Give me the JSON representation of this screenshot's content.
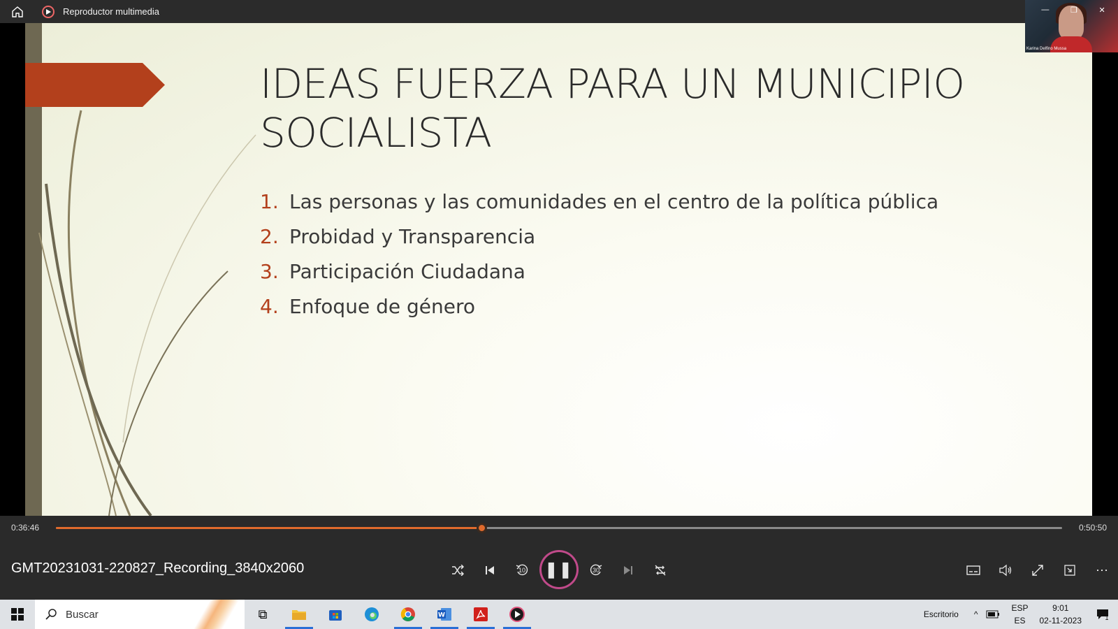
{
  "window": {
    "app_title": "Reproductor multimedia"
  },
  "slide": {
    "title": "IDEAS FUERZA PARA UN MUNICIPIO SOCIALISTA",
    "items": [
      {
        "num": "1.",
        "text": "Las personas y las comunidades en el centro de la política pública"
      },
      {
        "num": "2.",
        "text": "Probidad y Transparencia"
      },
      {
        "num": "3.",
        "text": "Participación Ciudadana"
      },
      {
        "num": "4.",
        "text": "Enfoque de género"
      }
    ],
    "accent_color": "#b3401c"
  },
  "webcam": {
    "participant_name": "Karina Delfino Mussa"
  },
  "player": {
    "current_time": "0:36:46",
    "total_time": "0:50:50",
    "progress_fraction": 0.4227,
    "filename": "GMT20231031-220827_Recording_3840x2060",
    "accent_color": "#e06a2c",
    "skip_back_label": "10",
    "skip_forward_label": "30",
    "controls": [
      "shuffle-icon",
      "previous-icon",
      "skip-back-10-icon",
      "pause-icon",
      "skip-forward-30-icon",
      "next-icon",
      "repeat-off-icon",
      "subtitles-icon",
      "volume-icon",
      "fullscreen-icon",
      "miniplayer-icon",
      "more-icon"
    ]
  },
  "taskbar": {
    "search_placeholder": "Buscar",
    "desktop_label": "Escritorio",
    "language_top": "ESP",
    "language_bottom": "ES",
    "time": "9:01",
    "date": "02-11-2023",
    "notification_count": "1"
  }
}
